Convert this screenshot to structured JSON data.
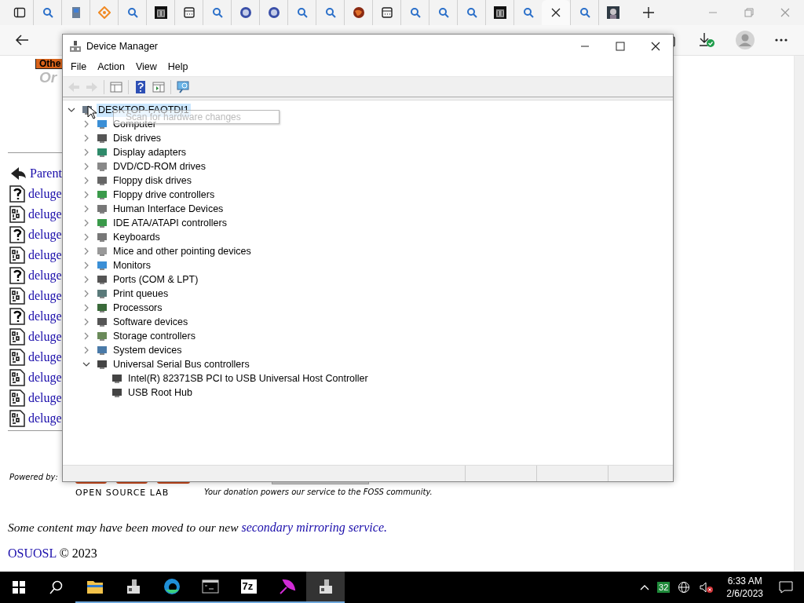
{
  "browser": {
    "tabs": [
      {
        "kind": "search",
        "selected": false
      },
      {
        "kind": "computer",
        "selected": false
      },
      {
        "kind": "diamond",
        "selected": false
      },
      {
        "kind": "search",
        "selected": false
      },
      {
        "kind": "library",
        "selected": false
      },
      {
        "kind": "window",
        "selected": false
      },
      {
        "kind": "search",
        "selected": false
      },
      {
        "kind": "globe",
        "selected": false
      },
      {
        "kind": "globe",
        "selected": false
      },
      {
        "kind": "search",
        "selected": false
      },
      {
        "kind": "search",
        "selected": false
      },
      {
        "kind": "planet",
        "selected": false
      },
      {
        "kind": "window",
        "selected": false
      },
      {
        "kind": "search",
        "selected": false
      },
      {
        "kind": "search",
        "selected": false
      },
      {
        "kind": "search",
        "selected": false
      },
      {
        "kind": "library",
        "selected": false
      },
      {
        "kind": "search",
        "selected": false
      },
      {
        "kind": "blank",
        "selected": true
      },
      {
        "kind": "search",
        "selected": false
      },
      {
        "kind": "picture",
        "selected": false
      }
    ]
  },
  "page": {
    "badge": "Othe",
    "heading": "Or",
    "parent_link": "Parent",
    "files": [
      {
        "kind": "unknown",
        "name": "deluge"
      },
      {
        "kind": "binary",
        "name": "deluge"
      },
      {
        "kind": "unknown",
        "name": "deluge"
      },
      {
        "kind": "binary",
        "name": "deluge"
      },
      {
        "kind": "unknown",
        "name": "deluge"
      },
      {
        "kind": "binary",
        "name": "deluge"
      },
      {
        "kind": "unknown",
        "name": "deluge"
      },
      {
        "kind": "binary",
        "name": "deluge"
      },
      {
        "kind": "binary",
        "name": "deluge"
      },
      {
        "kind": "binary",
        "name": "deluge"
      },
      {
        "kind": "binary",
        "name": "deluge"
      },
      {
        "kind": "binary",
        "name": "deluge"
      }
    ],
    "powered_by": "Powered by:",
    "logo_caption": "OPEN SOURCE LAB",
    "donation_note": "Your donation powers our service to the FOSS community.",
    "notice": {
      "text": "Some content may have been moved to our new",
      "link": "secondary mirroring service."
    },
    "footer": {
      "link": "OSUOSL",
      "text": "© 2023"
    }
  },
  "device_manager": {
    "title": "Device Manager",
    "menu": [
      "File",
      "Action",
      "View",
      "Help"
    ],
    "toolbar": [
      {
        "kind": "back",
        "disabled": true
      },
      {
        "kind": "forward",
        "disabled": true
      },
      {
        "kind": "console",
        "disabled": false
      },
      {
        "kind": "help",
        "disabled": false
      },
      {
        "kind": "panel",
        "disabled": false
      },
      {
        "kind": "scan",
        "disabled": false
      }
    ],
    "tree": {
      "label": "DESKTOP-FAOTDI1",
      "kind": "computer",
      "expanded": true,
      "selected": true,
      "children": [
        {
          "label": "Computer",
          "kind": "monitor",
          "expanded": false,
          "selected": false
        },
        {
          "label": "Disk drives",
          "kind": "disk",
          "expanded": false,
          "selected": false
        },
        {
          "label": "Display adapters",
          "kind": "display",
          "expanded": false,
          "selected": false
        },
        {
          "label": "DVD/CD-ROM drives",
          "kind": "optical",
          "expanded": false,
          "selected": false
        },
        {
          "label": "Floppy disk drives",
          "kind": "floppy",
          "expanded": false,
          "selected": false
        },
        {
          "label": "Floppy drive controllers",
          "kind": "controller",
          "expanded": false,
          "selected": false
        },
        {
          "label": "Human Interface Devices",
          "kind": "keyboard",
          "expanded": false,
          "selected": false
        },
        {
          "label": "IDE ATA/ATAPI controllers",
          "kind": "controller",
          "expanded": false,
          "selected": false
        },
        {
          "label": "Keyboards",
          "kind": "keyboard",
          "expanded": false,
          "selected": false
        },
        {
          "label": "Mice and other pointing devices",
          "kind": "mouse",
          "expanded": false,
          "selected": false
        },
        {
          "label": "Monitors",
          "kind": "monitor",
          "expanded": false,
          "selected": false
        },
        {
          "label": "Ports (COM & LPT)",
          "kind": "port",
          "expanded": false,
          "selected": false
        },
        {
          "label": "Print queues",
          "kind": "printer",
          "expanded": false,
          "selected": false
        },
        {
          "label": "Processors",
          "kind": "chip",
          "expanded": false,
          "selected": false
        },
        {
          "label": "Software devices",
          "kind": "port",
          "expanded": false,
          "selected": false
        },
        {
          "label": "Storage controllers",
          "kind": "storage",
          "expanded": false,
          "selected": false
        },
        {
          "label": "System devices",
          "kind": "folder",
          "expanded": false,
          "selected": false
        },
        {
          "label": "Universal Serial Bus controllers",
          "kind": "usb",
          "expanded": true,
          "selected": false,
          "children": [
            {
              "label": "Intel(R) 82371SB PCI to USB Universal Host Controller",
              "kind": "usb",
              "selected": false
            },
            {
              "label": "USB Root Hub",
              "kind": "usb",
              "selected": false
            }
          ]
        }
      ]
    },
    "tooltip": "Scan for hardware changes"
  },
  "taskbar": {
    "apps": [
      {
        "kind": "folder",
        "active": false
      },
      {
        "kind": "device",
        "active": false
      },
      {
        "kind": "browser",
        "active": false
      },
      {
        "kind": "terminal",
        "active": false
      },
      {
        "kind": "archiver",
        "label": "7z",
        "active": false
      },
      {
        "kind": "feather",
        "active": false
      },
      {
        "kind": "device",
        "active": true
      }
    ],
    "tray": {
      "badge": "32",
      "time": "6:33 AM",
      "date": "2/6/2023"
    }
  }
}
